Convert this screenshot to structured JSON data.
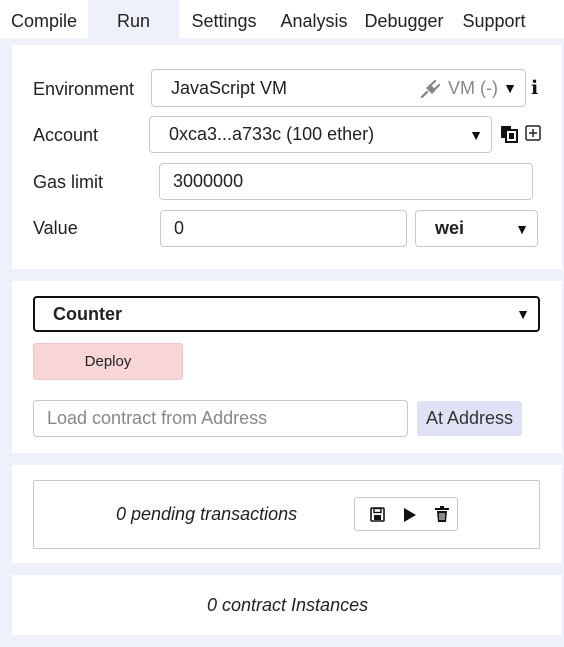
{
  "tabs": [
    {
      "label": "Compile"
    },
    {
      "label": "Run"
    },
    {
      "label": "Settings"
    },
    {
      "label": "Analysis"
    },
    {
      "label": "Debugger"
    },
    {
      "label": "Support"
    }
  ],
  "settings": {
    "environment": {
      "label": "Environment",
      "value": "JavaScript VM",
      "badge": "VM (-)"
    },
    "account": {
      "label": "Account",
      "value": "0xca3...a733c (100 ether)"
    },
    "gas_limit": {
      "label": "Gas limit",
      "value": "3000000"
    },
    "value": {
      "label": "Value",
      "amount": "0",
      "unit": "wei"
    }
  },
  "deploy": {
    "contract": "Counter",
    "deploy_label": "Deploy",
    "address_placeholder": "Load contract from Address",
    "at_address_label": "At Address"
  },
  "transactions": {
    "pending_text": "0 pending transactions"
  },
  "instances": {
    "text": "0 contract Instances"
  },
  "icons": [
    "plug-icon",
    "info-icon",
    "copy-icon",
    "plus-square-icon",
    "save-icon",
    "play-icon",
    "trash-icon",
    "chevron-down-icon"
  ]
}
